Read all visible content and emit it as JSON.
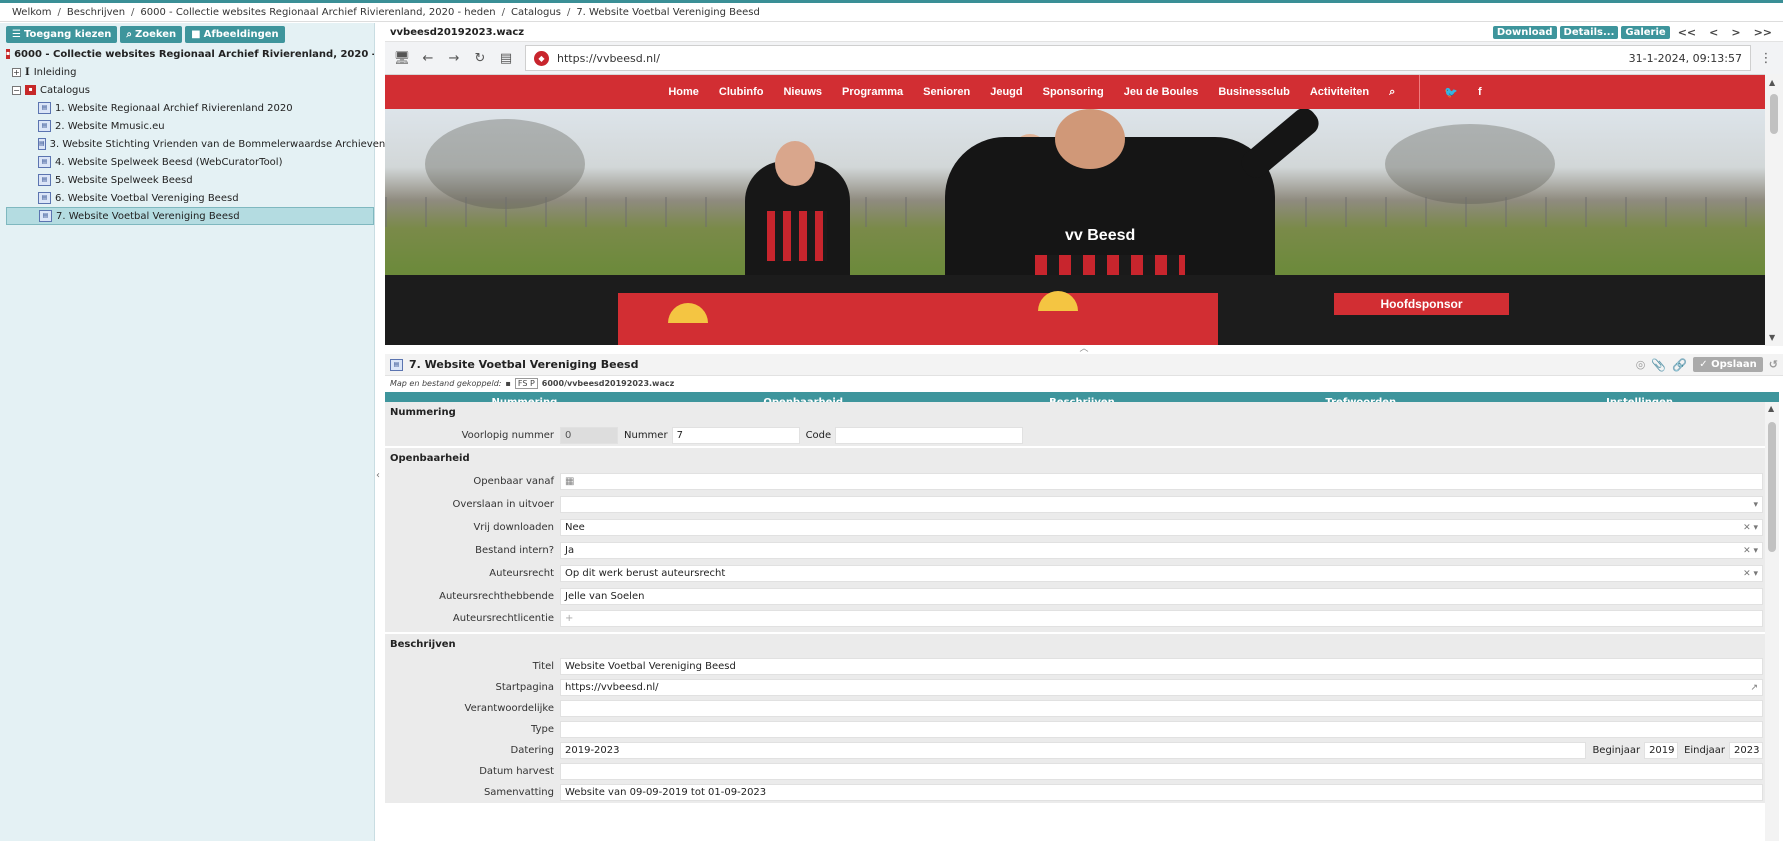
{
  "breadcrumb": [
    "Welkom",
    "Beschrijven",
    "6000 - Collectie websites Regionaal Archief Rivierenland, 2020 - heden",
    "Catalogus",
    "7. Website Voetbal Vereniging Beesd"
  ],
  "sidebar": {
    "buttons": {
      "toegang": "Toegang kiezen",
      "zoeken": "Zoeken",
      "afbeeldingen": "Afbeeldingen"
    },
    "root": "6000 - Collectie websites Regionaal Archief Rivierenland, 2020 - heden",
    "inleiding": "Inleiding",
    "catalogus": "Catalogus",
    "items": [
      {
        "label": "1. Website Regionaal Archief Rivierenland 2020"
      },
      {
        "label": "2. Website Mmusic.eu"
      },
      {
        "label": "3. Website Stichting Vrienden van de Bommelerwaardse Archieven"
      },
      {
        "label": "4. Website Spelweek Beesd (WebCuratorTool)"
      },
      {
        "label": "5. Website Spelweek Beesd"
      },
      {
        "label": "6. Website Voetbal Vereniging Beesd"
      },
      {
        "label": "7. Website Voetbal Vereniging Beesd"
      }
    ]
  },
  "viewer": {
    "filename": "vvbeesd20192023.wacz",
    "buttons": {
      "download": "Download",
      "details": "Details...",
      "galerie": "Galerie"
    },
    "nav": [
      "<<",
      "<",
      ">",
      ">>"
    ],
    "url": "https://vvbeesd.nl/",
    "datetime": "31-1-2024, 09:13:57"
  },
  "site": {
    "menu": [
      "Home",
      "Clubinfo",
      "Nieuws",
      "Programma",
      "Senioren",
      "Jeugd",
      "Sponsoring",
      "Jeu de Boules",
      "Businessclub",
      "Activiteiten"
    ],
    "jersey_text": "vv Beesd",
    "sponsor": "Hoofdsponsor"
  },
  "record": {
    "title": "7. Website Voetbal Vereniging Beesd",
    "opslaan": "Opslaan",
    "link_label": "Map en bestand gekoppeld:",
    "link_badge": "FS P",
    "link_path": "6000/vvbeesd20192023.wacz",
    "tabs": [
      "Nummering",
      "Openbaarheid",
      "Beschrijven",
      "Trefwoorden",
      "Instellingen"
    ]
  },
  "nummering": {
    "heading": "Nummering",
    "voorlopig_label": "Voorlopig nummer",
    "voorlopig_value": "0",
    "nummer_label": "Nummer",
    "nummer_value": "7",
    "code_label": "Code",
    "code_value": ""
  },
  "openbaarheid": {
    "heading": "Openbaarheid",
    "fields": [
      {
        "label": "Openbaar vanaf",
        "value": ""
      },
      {
        "label": "Overslaan in uitvoer",
        "value": ""
      },
      {
        "label": "Vrij downloaden",
        "value": "Nee"
      },
      {
        "label": "Bestand intern?",
        "value": "Ja"
      },
      {
        "label": "Auteursrecht",
        "value": "Op dit werk berust auteursrecht"
      },
      {
        "label": "Auteursrechthebbende",
        "value": "Jelle van Soelen"
      },
      {
        "label": "Auteursrechtlicentie",
        "value": ""
      }
    ]
  },
  "beschrijven": {
    "heading": "Beschrijven",
    "titel_label": "Titel",
    "titel_value": "Website Voetbal Vereniging Beesd",
    "startpagina_label": "Startpagina",
    "startpagina_value": "https://vvbeesd.nl/",
    "verantwoordelijke_label": "Verantwoordelijke",
    "type_label": "Type",
    "datering_label": "Datering",
    "datering_value": "2019-2023",
    "beginjaar_label": "Beginjaar",
    "beginjaar_value": "2019",
    "eindjaar_label": "Eindjaar",
    "eindjaar_value": "2023",
    "harvest_label": "Datum harvest",
    "samenvatting_label": "Samenvatting",
    "samenvatting_value": "Website van 09-09-2019 tot 01-09-2023"
  },
  "colors": {
    "accent": "#3e959c",
    "site_red": "#d22e33",
    "sidebar_bg": "#e4f1f4"
  }
}
